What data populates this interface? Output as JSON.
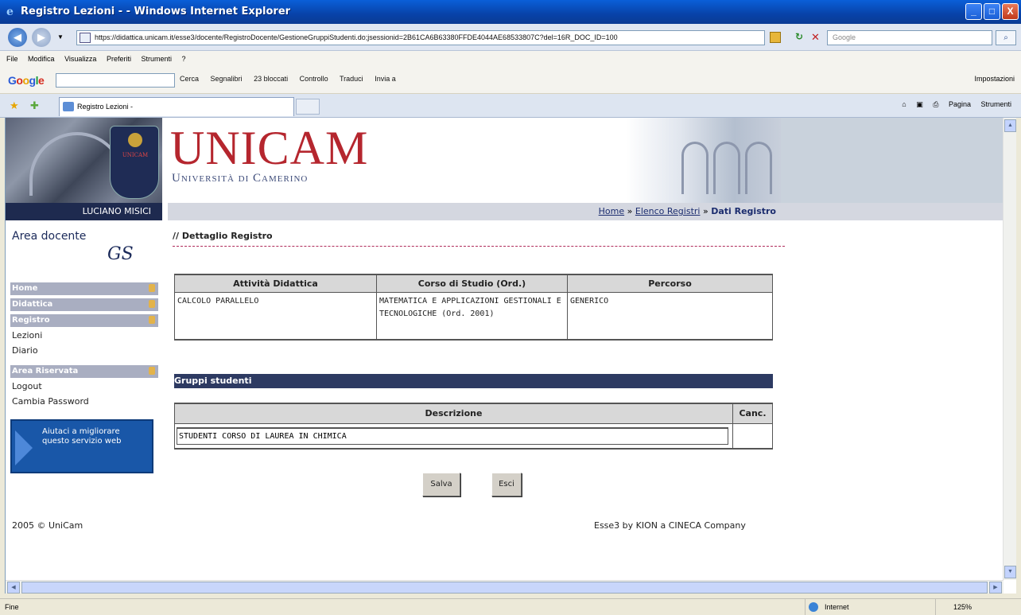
{
  "window": {
    "title": "Registro Lezioni - - Windows Internet Explorer",
    "minimize": "_",
    "maximize": "□",
    "close": "X"
  },
  "addressbar": {
    "url": "https://didattica.unicam.it/esse3/docente/RegistroDocente/GestioneGruppiStudenti.do;jsessionid=2B61CA6B63380FFDE4044AE68533807C?del=16R_DOC_ID=100",
    "search_placeholder": "Google",
    "back_icon": "back-arrow-icon",
    "forward_icon": "forward-arrow-icon"
  },
  "menubar": {
    "items": [
      "File",
      "Modifica",
      "Visualizza",
      "Preferiti",
      "Strumenti",
      "?"
    ]
  },
  "google_toolbar": {
    "logo": "Google",
    "items": [
      "Cerca",
      "Segnalibri",
      "23 bloccati",
      "Controllo",
      "Traduci",
      "Invia a"
    ],
    "settings": "Impostazioni"
  },
  "tabs": {
    "active_tab": "Registro Lezioni -",
    "commands": [
      "Pagina",
      "Strumenti"
    ]
  },
  "header": {
    "brand": "UNICAM",
    "university": "Università di Camerino",
    "crest_text": "UNICAM",
    "user": "LUCIANO MISICI"
  },
  "breadcrumb": {
    "home": "Home",
    "sep1": "»",
    "elenco": "Elenco Registri",
    "sep2": "»",
    "current": "Dati Registro"
  },
  "sidebar": {
    "title": "Area docente",
    "signature": "GS",
    "sections": [
      {
        "label": "Home"
      },
      {
        "label": "Didattica"
      },
      {
        "label": "Registro"
      }
    ],
    "registro_items": [
      "Lezioni",
      "Diario"
    ],
    "area_riservata": "Area Riservata",
    "riservata_items": [
      "Logout",
      "Cambia Password"
    ],
    "help_text": "Aiutaci a migliorare questo servizio web"
  },
  "main": {
    "section_title": "// Dettaglio Registro",
    "table_headers": [
      "Attività Didattica",
      "Corso di Studio (Ord.)",
      "Percorso"
    ],
    "table_row": {
      "attivita": "CALCOLO PARALLELO",
      "corso": "MATEMATICA E APPLICAZIONI GESTIONALI E TECNOLOGICHE (Ord. 2001)",
      "percorso": "GENERICO"
    },
    "gruppi_title": "Gruppi studenti",
    "gruppi_headers": [
      "Descrizione",
      "Canc."
    ],
    "gruppi_value": "STUDENTI CORSO DI LAUREA IN CHIMICA",
    "save_label": "Salva",
    "exit_label": "Esci"
  },
  "footer": {
    "left": "2005 © UniCam",
    "right": "Esse3 by KION a CINECA Company"
  },
  "statusbar": {
    "status": "Fine",
    "zone": "Internet",
    "zoom": "125%"
  }
}
